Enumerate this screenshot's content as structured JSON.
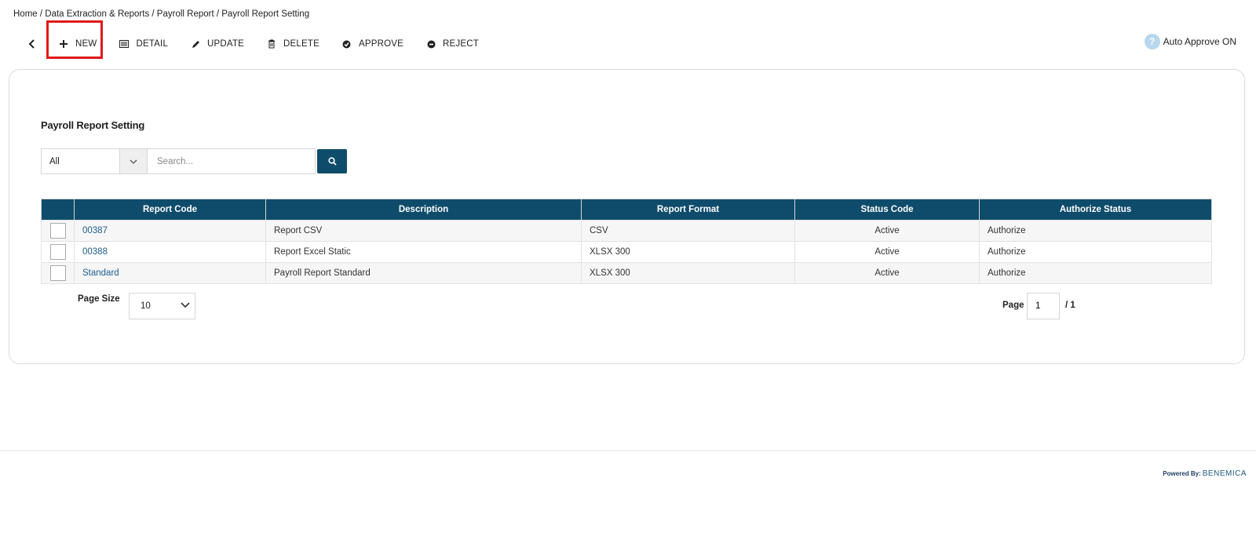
{
  "breadcrumb": "Home / Data Extraction & Reports / Payroll Report / Payroll Report Setting",
  "toolbar": {
    "new": "NEW",
    "detail": "DETAIL",
    "update": "UPDATE",
    "delete": "DELETE",
    "approve": "APPROVE",
    "reject": "REJECT"
  },
  "auto_approve": {
    "icon": "?",
    "label": "Auto Approve ON"
  },
  "card": {
    "title": "Payroll Report Setting",
    "filter_value": "All",
    "search_placeholder": "Search..."
  },
  "table": {
    "columns": [
      "Report Code",
      "Description",
      "Report Format",
      "Status Code",
      "Authorize Status"
    ],
    "rows": [
      {
        "code": "00387",
        "description": "Report CSV",
        "format": "CSV",
        "status": "Active",
        "authorize": "Authorize"
      },
      {
        "code": "00388",
        "description": "Report Excel Static",
        "format": "XLSX 300",
        "status": "Active",
        "authorize": "Authorize"
      },
      {
        "code": "Standard",
        "description": "Payroll Report Standard",
        "format": "XLSX 300",
        "status": "Active",
        "authorize": "Authorize"
      }
    ]
  },
  "pagination": {
    "page_size_label": "Page Size",
    "page_size": "10",
    "page_label": "Page",
    "page_value": "1",
    "page_total": "/ 1"
  },
  "footer": {
    "powered_by": "Powered By:",
    "brand": "BENEMICA"
  },
  "colors": {
    "header_bg": "#0f4c6b",
    "link": "#1c5e8c",
    "highlight": "#e01919"
  }
}
